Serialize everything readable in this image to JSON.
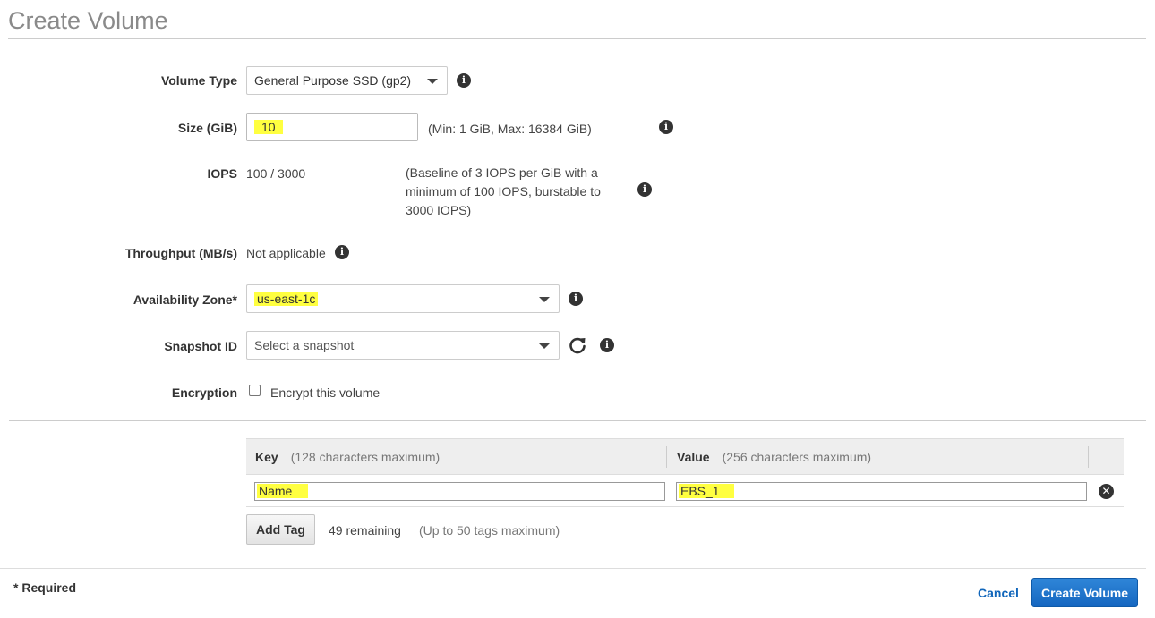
{
  "page": {
    "title": "Create Volume"
  },
  "form": {
    "volume_type": {
      "label": "Volume Type",
      "value": "General Purpose SSD (gp2)"
    },
    "size": {
      "label": "Size (GiB)",
      "value": "10",
      "hint": "(Min: 1 GiB, Max: 16384 GiB)"
    },
    "iops": {
      "label": "IOPS",
      "value": "100 / 3000",
      "hint": "(Baseline of 3 IOPS per GiB with a minimum of 100 IOPS, burstable to 3000 IOPS)"
    },
    "throughput": {
      "label": "Throughput (MB/s)",
      "value": "Not applicable"
    },
    "availability_zone": {
      "label": "Availability Zone*",
      "value": "us-east-1c"
    },
    "snapshot": {
      "label": "Snapshot ID",
      "placeholder": "Select a snapshot"
    },
    "encryption": {
      "label": "Encryption",
      "checkbox_label": "Encrypt this volume",
      "checked": false
    }
  },
  "tags": {
    "key_header": "Key",
    "key_hint": "(128 characters maximum)",
    "value_header": "Value",
    "value_hint": "(256 characters maximum)",
    "rows": [
      {
        "key": "Name",
        "value": "EBS_1"
      }
    ],
    "add_label": "Add Tag",
    "remaining": "49 remaining",
    "max_hint": "(Up to 50 tags maximum)"
  },
  "footer": {
    "required_note": "* Required",
    "cancel_label": "Cancel",
    "create_label": "Create Volume"
  },
  "icons": {
    "info": "info-icon",
    "refresh": "refresh-icon",
    "remove": "remove-icon"
  },
  "colors": {
    "highlight": "#ffff40",
    "primary_button": "#1566c0",
    "link": "#1166bb"
  }
}
